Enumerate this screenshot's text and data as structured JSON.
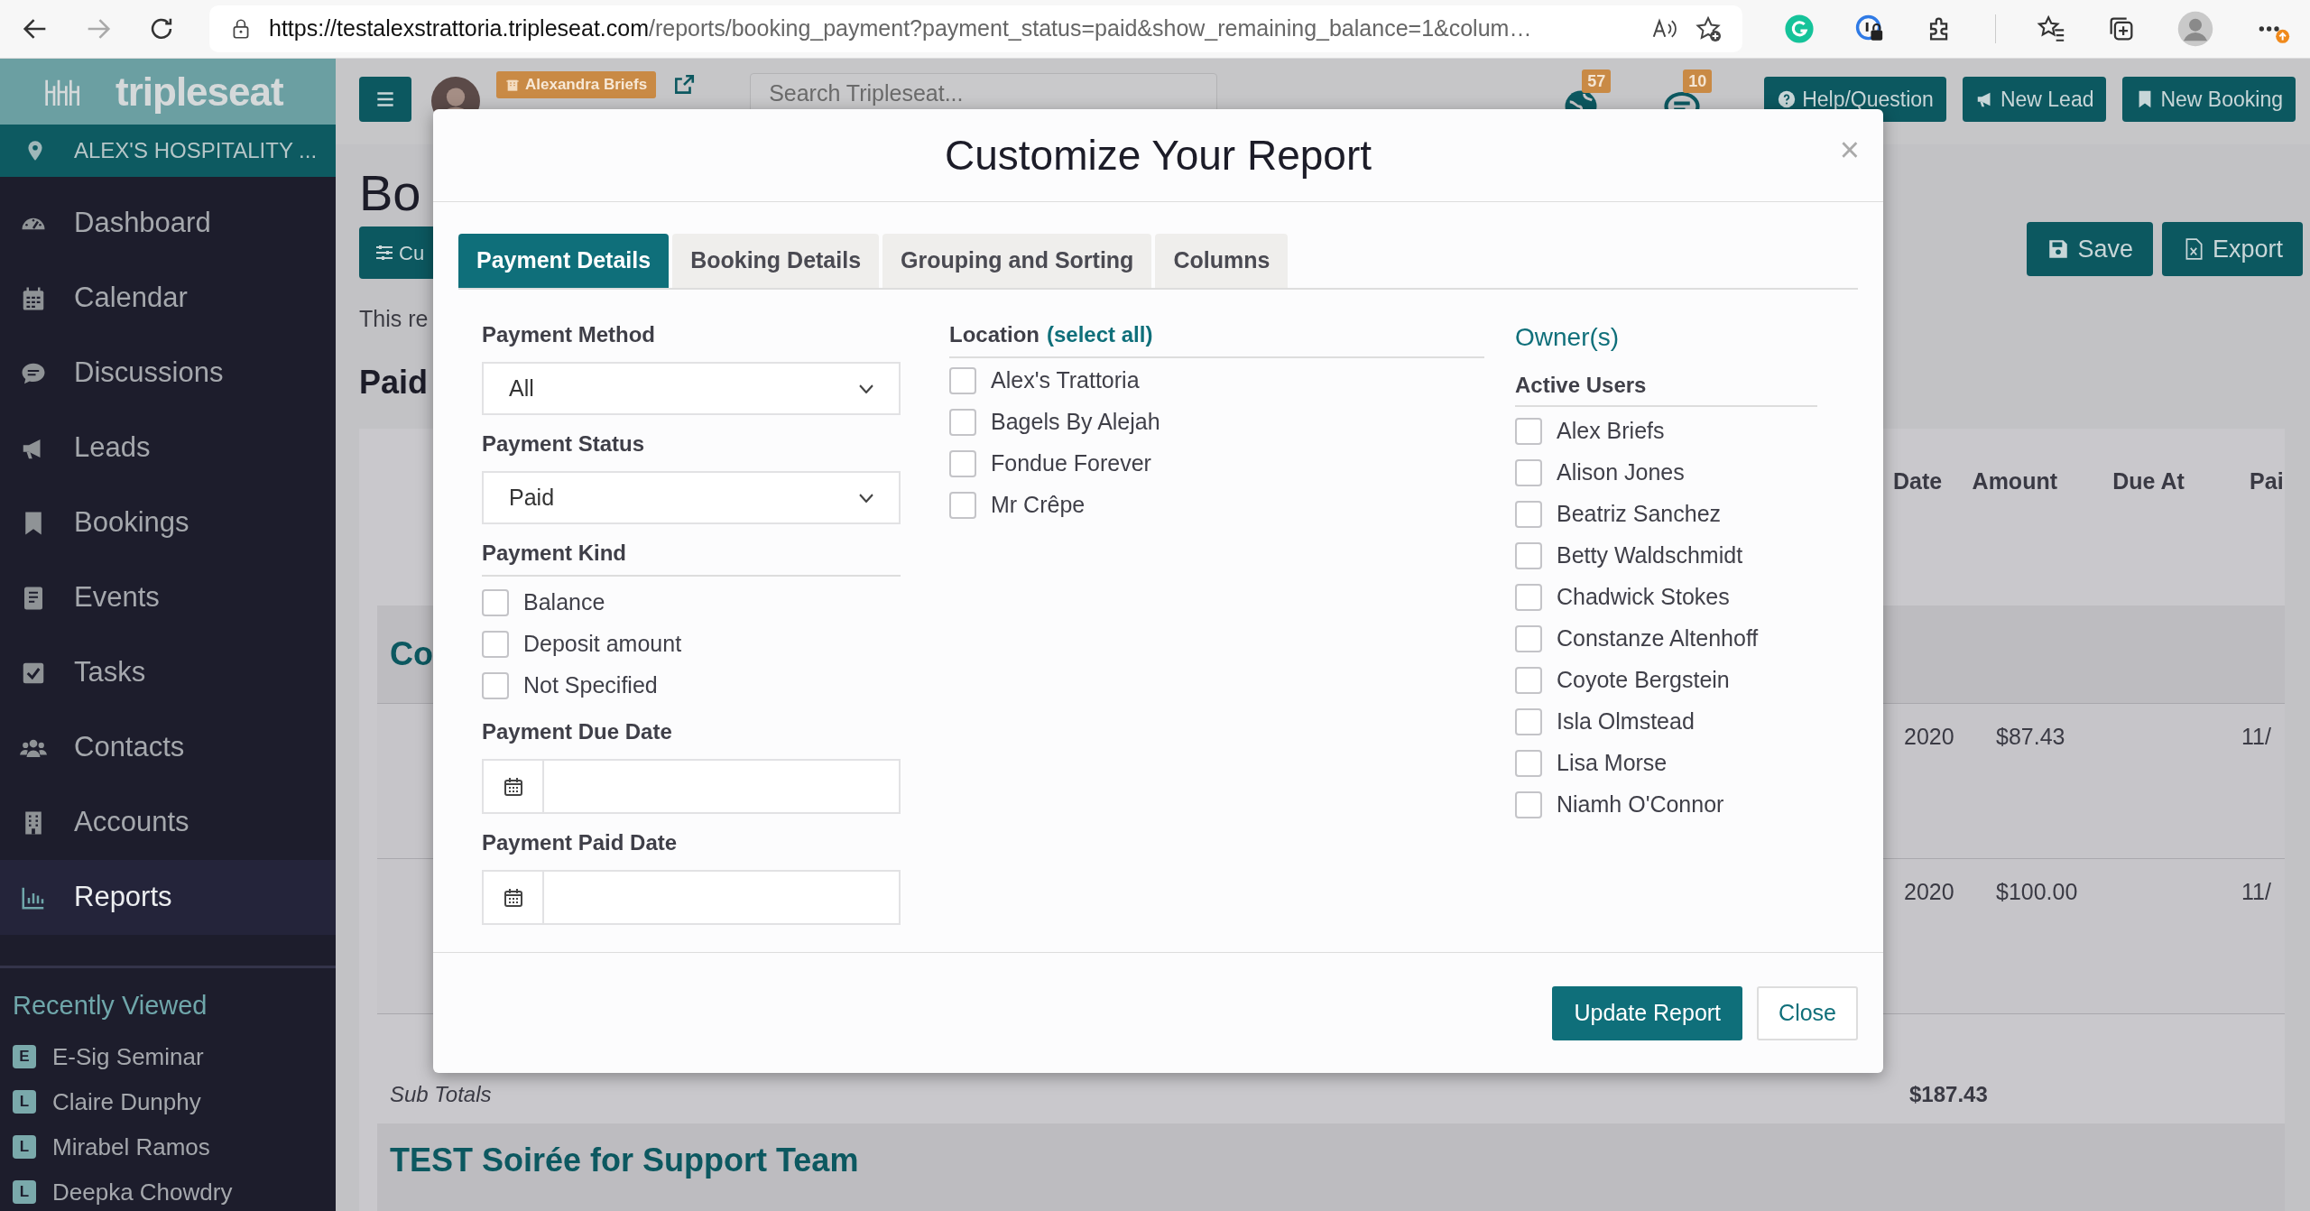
{
  "browser": {
    "url_host": "https://testalexstrattoria.tripleseat.com",
    "url_path": "/reports/booking_payment?payment_status=paid&show_remaining_balance=1&colum…"
  },
  "sidebar": {
    "brand": "tripleseat",
    "location": "ALEX'S HOSPITALITY ...",
    "items": [
      {
        "label": "Dashboard",
        "selected": false
      },
      {
        "label": "Calendar",
        "selected": false
      },
      {
        "label": "Discussions",
        "selected": false
      },
      {
        "label": "Leads",
        "selected": false
      },
      {
        "label": "Bookings",
        "selected": false
      },
      {
        "label": "Events",
        "selected": false
      },
      {
        "label": "Tasks",
        "selected": false
      },
      {
        "label": "Contacts",
        "selected": false
      },
      {
        "label": "Accounts",
        "selected": false
      },
      {
        "label": "Reports",
        "selected": true
      }
    ],
    "recently_viewed": {
      "heading": "Recently Viewed",
      "items": [
        {
          "badge": "E",
          "label": "E-Sig Seminar"
        },
        {
          "badge": "L",
          "label": "Claire Dunphy"
        },
        {
          "badge": "L",
          "label": "Mirabel Ramos"
        },
        {
          "badge": "L",
          "label": "Deepka Chowdry"
        }
      ]
    }
  },
  "header": {
    "user_badge": "Alexandra Briefs",
    "search": {
      "placeholder": "Search Tripleseat..."
    },
    "notifications": [
      "57",
      "10"
    ],
    "buttons": [
      "Help/Question",
      "New Lead",
      "New Booking"
    ]
  },
  "page": {
    "title": "Bo",
    "customize_button": "Cu",
    "description": "This re",
    "section_title": "Paid",
    "save_button": "Save",
    "export_button": "Export",
    "columns": [
      "Date",
      "Amount",
      "Due At",
      "Pai"
    ],
    "group_title": "Co",
    "rows": [
      {
        "date": "2020",
        "amount": "$87.43",
        "paid": "11/"
      },
      {
        "date": "2020",
        "amount": "$100.00",
        "paid": "11/"
      }
    ],
    "subtotal_label": "Sub Totals",
    "subtotal_amount": "$187.43",
    "next_group": "TEST Soirée for Support Team"
  },
  "modal": {
    "title": "Customize Your Report",
    "close": "×",
    "tabs": [
      {
        "label": "Payment Details",
        "selected": true
      },
      {
        "label": "Booking Details",
        "selected": false
      },
      {
        "label": "Grouping and Sorting",
        "selected": false
      },
      {
        "label": "Columns",
        "selected": false
      }
    ],
    "payment_method": {
      "label": "Payment Method",
      "value": "All"
    },
    "payment_status": {
      "label": "Payment Status",
      "value": "Paid"
    },
    "payment_kind": {
      "label": "Payment Kind",
      "options": [
        {
          "label": "Balance",
          "checked": false
        },
        {
          "label": "Deposit amount",
          "checked": false
        },
        {
          "label": "Not Specified",
          "checked": false
        }
      ]
    },
    "due_date": {
      "label": "Payment Due Date"
    },
    "paid_date": {
      "label": "Payment Paid Date"
    },
    "location": {
      "label": "Location",
      "select_all": "(select all)",
      "options": [
        {
          "label": "Alex's Trattoria",
          "checked": false
        },
        {
          "label": "Bagels By Alejah",
          "checked": false
        },
        {
          "label": "Fondue Forever",
          "checked": false
        },
        {
          "label": "Mr Crêpe",
          "checked": false
        }
      ]
    },
    "owners": {
      "title": "Owner(s)",
      "group": "Active Users",
      "options": [
        {
          "label": "Alex Briefs",
          "checked": false
        },
        {
          "label": "Alison Jones",
          "checked": false
        },
        {
          "label": "Beatriz Sanchez",
          "checked": false
        },
        {
          "label": "Betty Waldschmidt",
          "checked": false
        },
        {
          "label": "Chadwick Stokes",
          "checked": false
        },
        {
          "label": "Constanze Altenhoff",
          "checked": false
        },
        {
          "label": "Coyote Bergstein",
          "checked": false
        },
        {
          "label": "Isla Olmstead",
          "checked": false
        },
        {
          "label": "Lisa Morse",
          "checked": false
        },
        {
          "label": "Niamh O'Connor",
          "checked": false
        }
      ]
    },
    "buttons": {
      "primary": "Update Report",
      "secondary": "Close"
    }
  }
}
